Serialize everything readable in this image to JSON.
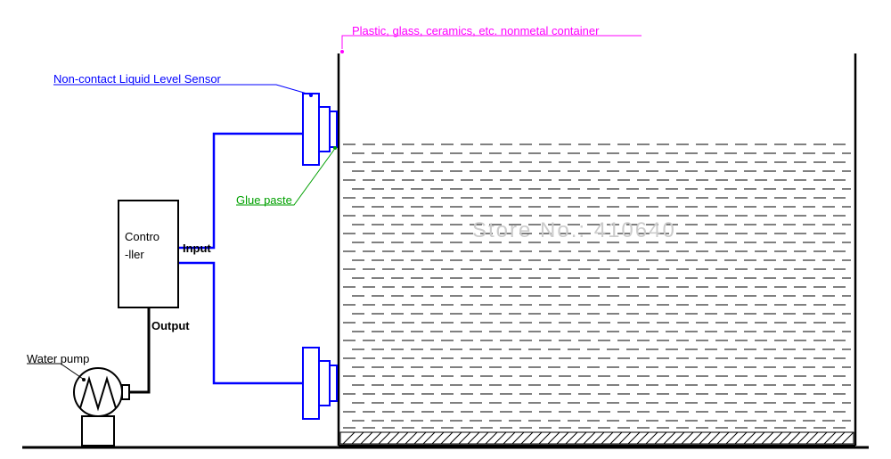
{
  "labels": {
    "container_material": "Plastic, glass, ceramics, etc. nonmetal container",
    "sensor_name": "Non-contact Liquid Level Sensor",
    "glue_paste": "Glue paste",
    "controller_line1": "Contro",
    "controller_line2": "-ller",
    "input": "Input",
    "output": "Output",
    "water_pump": "Water pump",
    "watermark": "Store No.: 410640"
  }
}
